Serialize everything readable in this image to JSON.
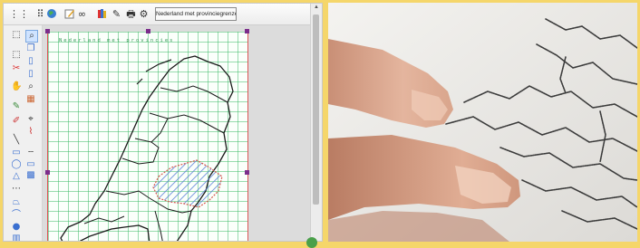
{
  "toolbar": {
    "document_title": "Nederland met provinciegrenzen",
    "icons": [
      "grid-icon",
      "globe-icon",
      "edit-icon",
      "glasses-icon",
      "books-icon",
      "compass-icon",
      "print-icon",
      "gear-icon"
    ]
  },
  "left_toolbar": {
    "icons": [
      "select-icon",
      "zoom-icon",
      "marquee-icon",
      "copy-icon",
      "lasso-icon",
      "eraser-icon",
      "pen-icon",
      "brush-icon",
      "line-icon",
      "dashed-line-icon",
      "rectangle-icon",
      "text-icon",
      "ellipse-icon",
      "pattern-icon",
      "triangle-icon",
      "hatch-icon",
      "polygon-icon",
      "curve-icon",
      "point-icon",
      "fill-icon"
    ]
  },
  "paper": {
    "title": "Nederland met provincies"
  },
  "colors": {
    "accent_frame": "#f5d66a",
    "grid_line": "#46be6e",
    "selection_handle": "#7b2d8b",
    "hatch_fill": "#5a7fd8"
  },
  "photo": {
    "description_alt": "finger-reading-tactile-map"
  }
}
